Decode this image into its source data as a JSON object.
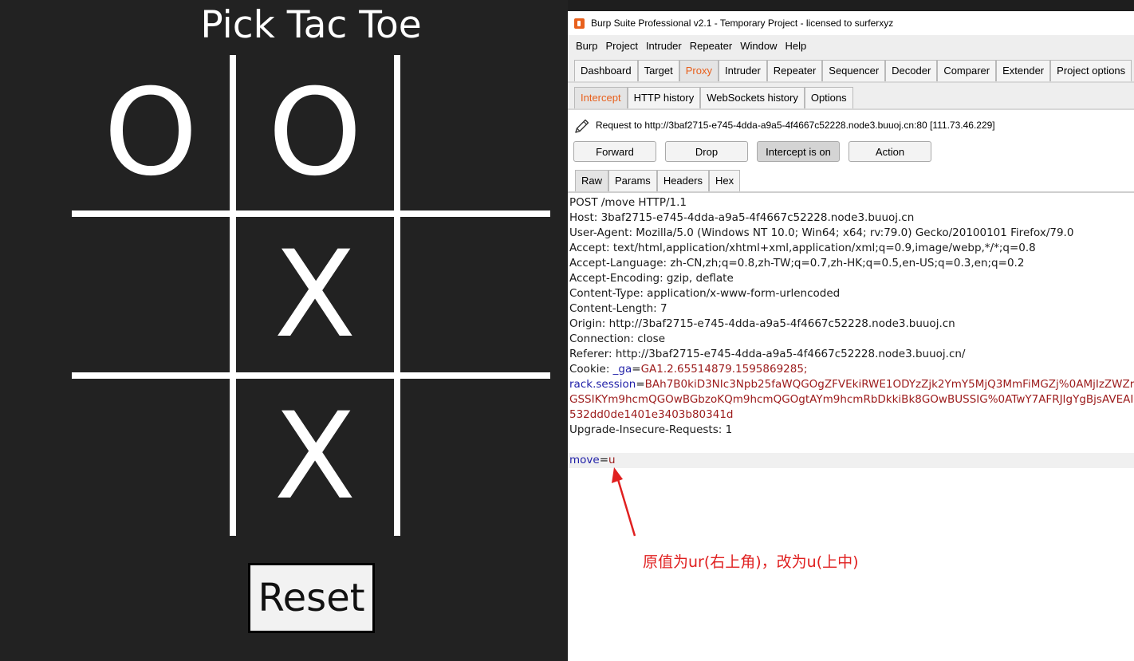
{
  "game": {
    "title": "Pick Tac Toe",
    "board": [
      "O",
      "O",
      "",
      "",
      "X",
      "",
      "",
      "X",
      ""
    ],
    "reset_label": "Reset"
  },
  "burp": {
    "window_title": "Burp Suite Professional v2.1 - Temporary Project - licensed to surferxyz",
    "menu": [
      "Burp",
      "Project",
      "Intruder",
      "Repeater",
      "Window",
      "Help"
    ],
    "main_tabs": [
      "Dashboard",
      "Target",
      "Proxy",
      "Intruder",
      "Repeater",
      "Sequencer",
      "Decoder",
      "Comparer",
      "Extender",
      "Project options"
    ],
    "active_main_tab": "Proxy",
    "sub_tabs": [
      "Intercept",
      "HTTP history",
      "WebSockets history",
      "Options"
    ],
    "active_sub_tab": "Intercept",
    "request_label": "Request to http://3baf2715-e745-4dda-a9a5-4f4667c52228.node3.buuoj.cn:80  [111.73.46.229]",
    "buttons": {
      "forward": "Forward",
      "drop": "Drop",
      "intercept": "Intercept is on",
      "action": "Action"
    },
    "view_tabs": [
      "Raw",
      "Params",
      "Headers",
      "Hex"
    ],
    "active_view_tab": "Raw",
    "accent_color": "#e8601c",
    "request_lines": [
      "POST /move HTTP/1.1",
      "Host: 3baf2715-e745-4dda-a9a5-4f4667c52228.node3.buuoj.cn",
      "User-Agent: Mozilla/5.0 (Windows NT 10.0; Win64; x64; rv:79.0) Gecko/20100101 Firefox/79.0",
      "Accept: text/html,application/xhtml+xml,application/xml;q=0.9,image/webp,*/*;q=0.8",
      "Accept-Language: zh-CN,zh;q=0.8,zh-TW;q=0.7,zh-HK;q=0.5,en-US;q=0.3,en;q=0.2",
      "Accept-Encoding: gzip, deflate",
      "Content-Type: application/x-www-form-urlencoded",
      "Content-Length: 7",
      "Origin: http://3baf2715-e745-4dda-a9a5-4f4667c52228.node3.buuoj.cn",
      "Connection: close",
      "Referer: http://3baf2715-e745-4dda-a9a5-4f4667c52228.node3.buuoj.cn/"
    ],
    "cookie": {
      "prefix": "Cookie: ",
      "ga_key": "_ga",
      "ga_value": "GA1.2.65514879.1595869285;",
      "session_key": "rack.session",
      "session_value_line1": "BAh7B0kiD3NIc3Npb25faWQGOgZFVEkiRWE1ODYzZjk2YmY5MjQ3MmFiMGZj%0AMjIzZWZr",
      "session_value_line2": "GSSIKYm9hcmQGOwBGbzoKQm9hcmQGOgtAYm9hcmRbDkkiBk8GOwBUSSIG%0ATwY7AFRJIgYgBjsAVEAI",
      "session_value_line3": "532dd0de1401e3403b80341d"
    },
    "upgrade_line": "Upgrade-Insecure-Requests: 1",
    "body": {
      "key": "move",
      "value": "u"
    },
    "annotation": "原值为ur(右上角)，改为u(上中)"
  }
}
